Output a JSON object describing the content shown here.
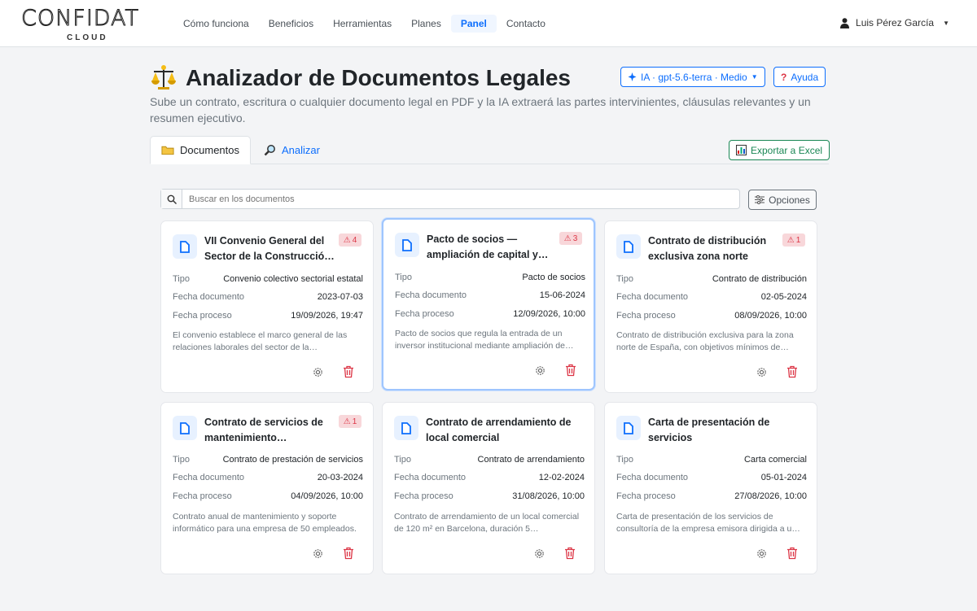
{
  "nav": {
    "logo": "CONFIDAT",
    "logo_sub": "CLOUD",
    "items": [
      "Cómo funciona",
      "Beneficios",
      "Herramientas",
      "Planes",
      "Panel",
      "Contacto"
    ],
    "active": "Panel",
    "user": "Luis Pérez García"
  },
  "header": {
    "title": "Analizador de Documentos Legales",
    "subtitle": "Sube un contrato, escritura o cualquier documento legal en PDF y la IA extraerá las partes intervinientes, cláusulas relevantes y un resumen ejecutivo.",
    "model": "IA · gpt-5.6-terra · Medio",
    "help": "Ayuda"
  },
  "tabs": {
    "documents": "Documentos",
    "analyze": "Analizar",
    "export": "Exportar a Excel"
  },
  "search": {
    "placeholder": "Buscar en los documentos",
    "options": "Opciones"
  },
  "labels": {
    "type": "Tipo",
    "doc_date": "Fecha documento",
    "proc_date": "Fecha proceso"
  },
  "cards": [
    {
      "title": "VII Convenio General del Sector de la Construcció…",
      "badge": "4",
      "type": "Convenio colectivo sectorial estatal",
      "doc_date": "2023-07-03",
      "proc_date": "19/09/2026, 19:47",
      "summary": "El convenio establece el marco general de las relaciones laborales del sector de la…"
    },
    {
      "title": "Pacto de socios — ampliación de capital y…",
      "badge": "3",
      "type": "Pacto de socios",
      "doc_date": "15-06-2024",
      "proc_date": "12/09/2026, 10:00",
      "summary": "Pacto de socios que regula la entrada de un inversor institucional mediante ampliación de…"
    },
    {
      "title": "Contrato de distribución exclusiva zona norte",
      "badge": "1",
      "type": "Contrato de distribución",
      "doc_date": "02-05-2024",
      "proc_date": "08/09/2026, 10:00",
      "summary": "Contrato de distribución exclusiva para la zona norte de España, con objetivos mínimos de…"
    },
    {
      "title": "Contrato de servicios de mantenimiento…",
      "badge": "1",
      "type": "Contrato de prestación de servicios",
      "doc_date": "20-03-2024",
      "proc_date": "04/09/2026, 10:00",
      "summary": "Contrato anual de mantenimiento y soporte informático para una empresa de 50 empleados."
    },
    {
      "title": "Contrato de arrendamiento de local comercial",
      "badge": "",
      "type": "Contrato de arrendamiento",
      "doc_date": "12-02-2024",
      "proc_date": "31/08/2026, 10:00",
      "summary": "Contrato de arrendamiento de un local comercial de 120 m² en Barcelona, duración 5…"
    },
    {
      "title": "Carta de presentación de servicios",
      "badge": "",
      "type": "Carta comercial",
      "doc_date": "05-01-2024",
      "proc_date": "27/08/2026, 10:00",
      "summary": "Carta de presentación de los servicios de consultoría de la empresa emisora dirigida a u…"
    }
  ]
}
